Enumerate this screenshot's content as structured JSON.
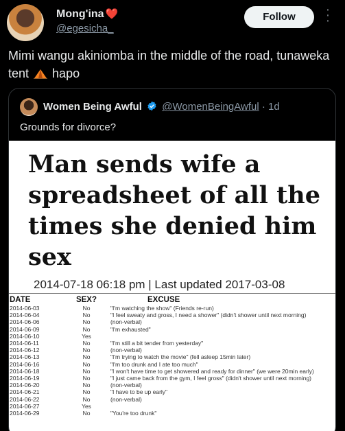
{
  "tweet": {
    "author_name": "Mong'ina",
    "heart_emoji": "❤️",
    "author_handle": "@egesicha_",
    "follow_label": "Follow",
    "text_before_emoji": "Mimi wangu akiniomba in the middle of the road, tunaweka tent",
    "text_after_emoji": " hapo",
    "emoji_icon": "tent-icon"
  },
  "quoted": {
    "author_name": "Women Being Awful",
    "handle": "@WomenBeingAwful",
    "time": "· 1d",
    "text": "Grounds for divorce?",
    "verified_color": "#1d9bf0"
  },
  "image": {
    "headline": "Man sends wife a spreadsheet of all the times she denied him sex",
    "dateline": "2014-07-18 06:18 pm | Last updated 2017-03-08",
    "columns": [
      "DATE",
      "SEX?",
      "EXCUSE"
    ],
    "rows": [
      {
        "date": "2014-06-03",
        "sex": "No",
        "excuse": "\"I'm watching the show\" (Friends re-run)"
      },
      {
        "date": "2014-06-04",
        "sex": "No",
        "excuse": "\"I feel sweaty and gross, I need a shower\" (didn't shower until next morning)"
      },
      {
        "date": "2014-06-06",
        "sex": "No",
        "excuse": "(non-verbal)"
      },
      {
        "date": "2014-06-09",
        "sex": "No",
        "excuse": "\"I'm exhausted\""
      },
      {
        "date": "2014-06-10",
        "sex": "Yes",
        "excuse": ""
      },
      {
        "date": "2014-06-11",
        "sex": "No",
        "excuse": "\"I'm still a bit tender from yesterday\""
      },
      {
        "date": "2014-06-12",
        "sex": "No",
        "excuse": "(non-verbal)"
      },
      {
        "date": "2014-06-13",
        "sex": "No",
        "excuse": "\"I'm trying to watch the movie\" (fell asleep 15min later)"
      },
      {
        "date": "2014-06-16",
        "sex": "No",
        "excuse": "\"I'm too drunk and I ate too much\""
      },
      {
        "date": "2014-06-18",
        "sex": "No",
        "excuse": "\"I won't have time to get showered and ready for dinner\" (we were 20min early)"
      },
      {
        "date": "2014-06-19",
        "sex": "No",
        "excuse": "\"I just came back from the gym, I feel gross\" (didn't shower until next morning)"
      },
      {
        "date": "2014-06-20",
        "sex": "No",
        "excuse": "(non-verbal)"
      },
      {
        "date": "2014-06-21",
        "sex": "No",
        "excuse": "\"I have to be up early\""
      },
      {
        "date": "2014-06-22",
        "sex": "No",
        "excuse": "(non-verbal)"
      },
      {
        "date": "2014-06-27",
        "sex": "Yes",
        "excuse": ""
      },
      {
        "date": "2014-06-29",
        "sex": "No",
        "excuse": "\"You're too drunk\""
      }
    ]
  }
}
